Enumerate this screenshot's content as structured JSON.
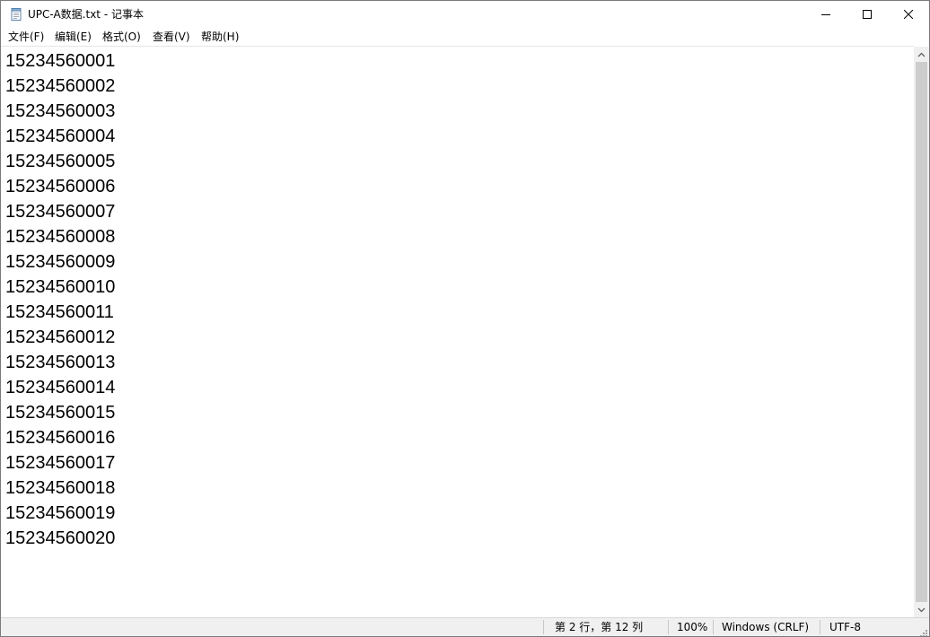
{
  "window": {
    "title": "UPC-A数据.txt - 记事本"
  },
  "menu": {
    "items": [
      {
        "label": "文件(F)"
      },
      {
        "label": "编辑(E)"
      },
      {
        "label": "格式(O)"
      },
      {
        "label": "查看(V)"
      },
      {
        "label": "帮助(H)"
      }
    ]
  },
  "editor": {
    "lines": [
      "15234560001",
      "15234560002",
      "15234560003",
      "15234560004",
      "15234560005",
      "15234560006",
      "15234560007",
      "15234560008",
      "15234560009",
      "15234560010",
      "15234560011",
      "15234560012",
      "15234560013",
      "15234560014",
      "15234560015",
      "15234560016",
      "15234560017",
      "15234560018",
      "15234560019",
      "15234560020"
    ]
  },
  "statusbar": {
    "position": "第 2 行，第 12 列",
    "zoom": "100%",
    "line_ending": "Windows (CRLF)",
    "encoding": "UTF-8"
  },
  "icons": {
    "app": "notepad-icon",
    "minimize": "minimize-icon",
    "maximize": "maximize-icon",
    "close": "close-icon",
    "scroll_up": "chevron-up-icon",
    "scroll_down": "chevron-down-icon"
  },
  "colors": {
    "window_border": "#7a7a7a",
    "statusbar_bg": "#f0f0f0",
    "scroll_track": "#f0f0f0",
    "scroll_thumb": "#cdcdcd",
    "text": "#000000"
  }
}
